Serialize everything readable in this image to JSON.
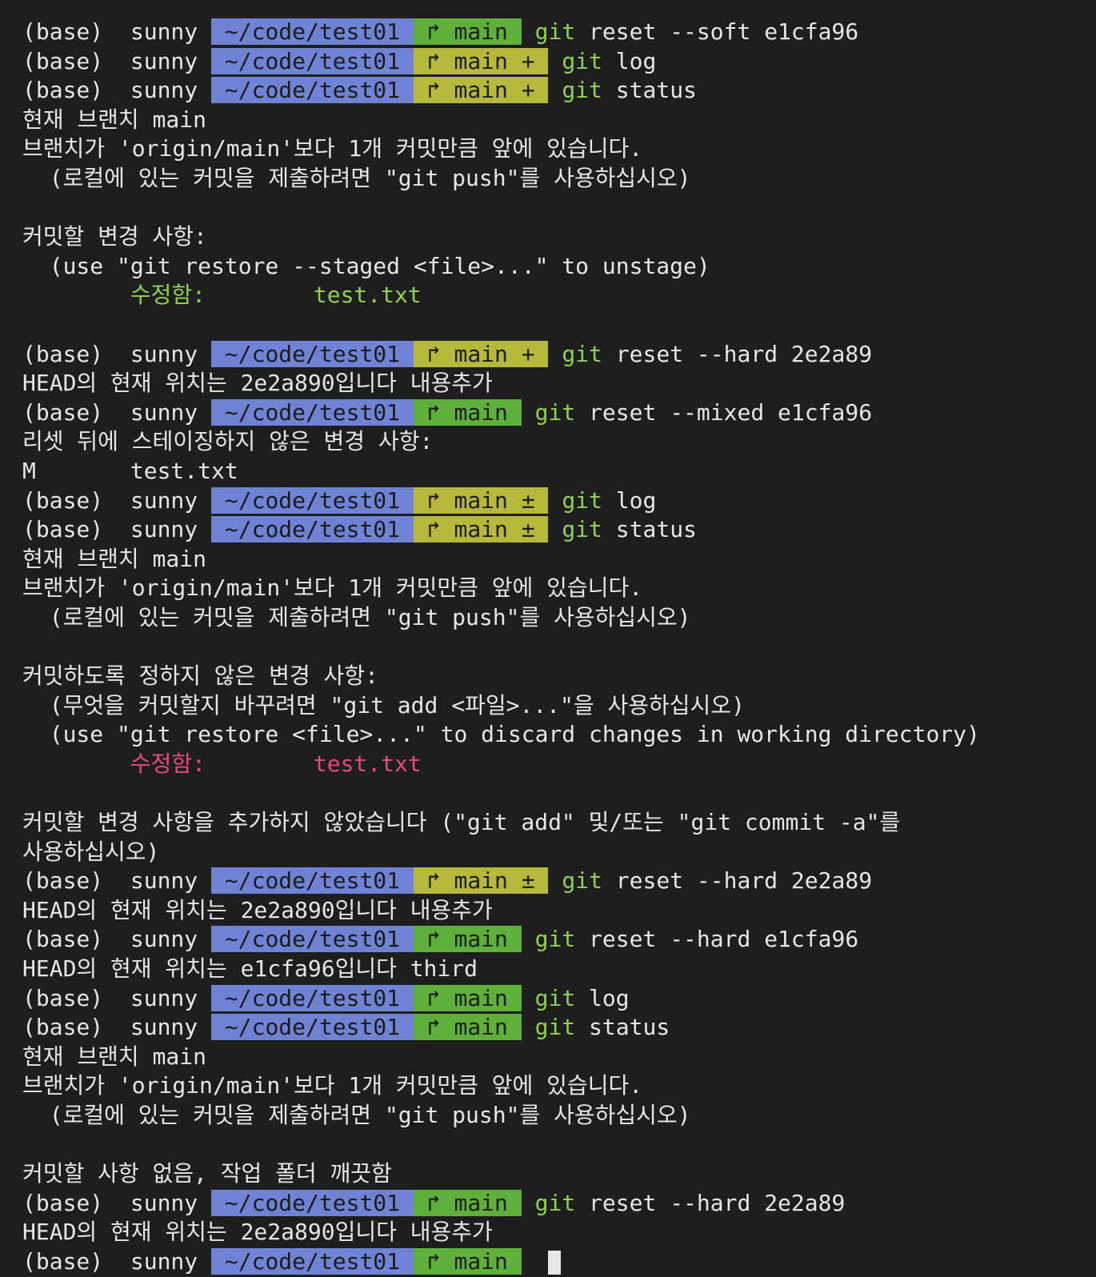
{
  "terminal": {
    "lines": [
      {
        "kind": "prompt",
        "context": "(base)  sunny ",
        "sep1": "",
        "dir": " ~/code/test01 ",
        "sep2": "",
        "branch": " ↱ main ",
        "state": "clean",
        "sep3": "",
        "command": "git",
        "args": "reset --soft e1cfa96"
      },
      {
        "kind": "prompt",
        "context": "(base)  sunny ",
        "sep1": "",
        "dir": " ~/code/test01 ",
        "sep2": "",
        "branch": " ↱ main + ",
        "state": "dirty",
        "sep3": "",
        "command": "git",
        "args": "log"
      },
      {
        "kind": "prompt",
        "context": "(base)  sunny ",
        "sep1": "",
        "dir": " ~/code/test01 ",
        "sep2": "",
        "branch": " ↱ main + ",
        "state": "dirty",
        "sep3": "",
        "command": "git",
        "args": "status"
      },
      {
        "kind": "text",
        "text": "현재 브랜치 main",
        "color": "plain"
      },
      {
        "kind": "text",
        "text": "브랜치가 'origin/main'보다 1개 커밋만큼 앞에 있습니다.",
        "color": "plain"
      },
      {
        "kind": "text",
        "text": "  (로컬에 있는 커밋을 제출하려면 \"git push\"를 사용하십시오)",
        "color": "plain"
      },
      {
        "kind": "text",
        "text": "",
        "color": "plain"
      },
      {
        "kind": "text",
        "text": "커밋할 변경 사항:",
        "color": "plain"
      },
      {
        "kind": "text",
        "text": "  (use \"git restore --staged <file>...\" to unstage)",
        "color": "plain"
      },
      {
        "kind": "text",
        "text": "        수정함:        test.txt",
        "color": "green"
      },
      {
        "kind": "text",
        "text": "",
        "color": "plain"
      },
      {
        "kind": "prompt",
        "context": "(base)  sunny ",
        "sep1": "",
        "dir": " ~/code/test01 ",
        "sep2": "",
        "branch": " ↱ main + ",
        "state": "dirty",
        "sep3": "",
        "command": "git",
        "args": "reset --hard 2e2a89"
      },
      {
        "kind": "text",
        "text": "HEAD의 현재 위치는 2e2a890입니다 내용추가",
        "color": "plain"
      },
      {
        "kind": "prompt",
        "context": "(base)  sunny ",
        "sep1": "",
        "dir": " ~/code/test01 ",
        "sep2": "",
        "branch": " ↱ main ",
        "state": "clean",
        "sep3": "",
        "command": "git",
        "args": "reset --mixed e1cfa96"
      },
      {
        "kind": "text",
        "text": "리셋 뒤에 스테이징하지 않은 변경 사항:",
        "color": "plain"
      },
      {
        "kind": "text",
        "text": "M       test.txt",
        "color": "plain"
      },
      {
        "kind": "prompt",
        "context": "(base)  sunny ",
        "sep1": "",
        "dir": " ~/code/test01 ",
        "sep2": "",
        "branch": " ↱ main ± ",
        "state": "dirty",
        "sep3": "",
        "command": "git",
        "args": "log"
      },
      {
        "kind": "prompt",
        "context": "(base)  sunny ",
        "sep1": "",
        "dir": " ~/code/test01 ",
        "sep2": "",
        "branch": " ↱ main ± ",
        "state": "dirty",
        "sep3": "",
        "command": "git",
        "args": "status"
      },
      {
        "kind": "text",
        "text": "현재 브랜치 main",
        "color": "plain"
      },
      {
        "kind": "text",
        "text": "브랜치가 'origin/main'보다 1개 커밋만큼 앞에 있습니다.",
        "color": "plain"
      },
      {
        "kind": "text",
        "text": "  (로컬에 있는 커밋을 제출하려면 \"git push\"를 사용하십시오)",
        "color": "plain"
      },
      {
        "kind": "text",
        "text": "",
        "color": "plain"
      },
      {
        "kind": "text",
        "text": "커밋하도록 정하지 않은 변경 사항:",
        "color": "plain"
      },
      {
        "kind": "text",
        "text": "  (무엇을 커밋할지 바꾸려면 \"git add <파일>...\"을 사용하십시오)",
        "color": "plain"
      },
      {
        "kind": "text",
        "text": "  (use \"git restore <file>...\" to discard changes in working directory)",
        "color": "plain"
      },
      {
        "kind": "text",
        "text": "        수정함:        test.txt",
        "color": "red"
      },
      {
        "kind": "text",
        "text": "",
        "color": "plain"
      },
      {
        "kind": "text",
        "text": "커밋할 변경 사항을 추가하지 않았습니다 (\"git add\" 및/또는 \"git commit -a\"를",
        "color": "plain"
      },
      {
        "kind": "text",
        "text": "사용하십시오)",
        "color": "plain"
      },
      {
        "kind": "prompt",
        "context": "(base)  sunny ",
        "sep1": "",
        "dir": " ~/code/test01 ",
        "sep2": "",
        "branch": " ↱ main ± ",
        "state": "dirty",
        "sep3": "",
        "command": "git",
        "args": "reset --hard 2e2a89"
      },
      {
        "kind": "text",
        "text": "HEAD의 현재 위치는 2e2a890입니다 내용추가",
        "color": "plain"
      },
      {
        "kind": "prompt",
        "context": "(base)  sunny ",
        "sep1": "",
        "dir": " ~/code/test01 ",
        "sep2": "",
        "branch": " ↱ main ",
        "state": "clean",
        "sep3": "",
        "command": "git",
        "args": "reset --hard e1cfa96"
      },
      {
        "kind": "text",
        "text": "HEAD의 현재 위치는 e1cfa96입니다 third",
        "color": "plain"
      },
      {
        "kind": "prompt",
        "context": "(base)  sunny ",
        "sep1": "",
        "dir": " ~/code/test01 ",
        "sep2": "",
        "branch": " ↱ main ",
        "state": "clean",
        "sep3": "",
        "command": "git",
        "args": "log"
      },
      {
        "kind": "prompt",
        "context": "(base)  sunny ",
        "sep1": "",
        "dir": " ~/code/test01 ",
        "sep2": "",
        "branch": " ↱ main ",
        "state": "clean",
        "sep3": "",
        "command": "git",
        "args": "status"
      },
      {
        "kind": "text",
        "text": "현재 브랜치 main",
        "color": "plain"
      },
      {
        "kind": "text",
        "text": "브랜치가 'origin/main'보다 1개 커밋만큼 앞에 있습니다.",
        "color": "plain"
      },
      {
        "kind": "text",
        "text": "  (로컬에 있는 커밋을 제출하려면 \"git push\"를 사용하십시오)",
        "color": "plain"
      },
      {
        "kind": "text",
        "text": "",
        "color": "plain"
      },
      {
        "kind": "text",
        "text": "커밋할 사항 없음, 작업 폴더 깨끗함",
        "color": "plain"
      },
      {
        "kind": "prompt",
        "context": "(base)  sunny ",
        "sep1": "",
        "dir": " ~/code/test01 ",
        "sep2": "",
        "branch": " ↱ main ",
        "state": "clean",
        "sep3": "",
        "command": "git",
        "args": "reset --hard 2e2a89"
      },
      {
        "kind": "text",
        "text": "HEAD의 현재 위치는 2e2a890입니다 내용추가",
        "color": "plain"
      },
      {
        "kind": "prompt",
        "context": "(base)  sunny ",
        "sep1": "",
        "dir": " ~/code/test01 ",
        "sep2": "",
        "branch": " ↱ main ",
        "state": "clean",
        "sep3": "",
        "command": "",
        "args": "",
        "cursor": true
      }
    ]
  },
  "colors": {
    "background": "#1e1e1e",
    "text": "#e6e6e6",
    "dir_segment": "#6f82d4",
    "git_clean_segment": "#5fb03a",
    "git_dirty_segment": "#b5b83a",
    "command": "#8fd14f",
    "staged": "#8fd14f",
    "unstaged": "#e8487a"
  }
}
